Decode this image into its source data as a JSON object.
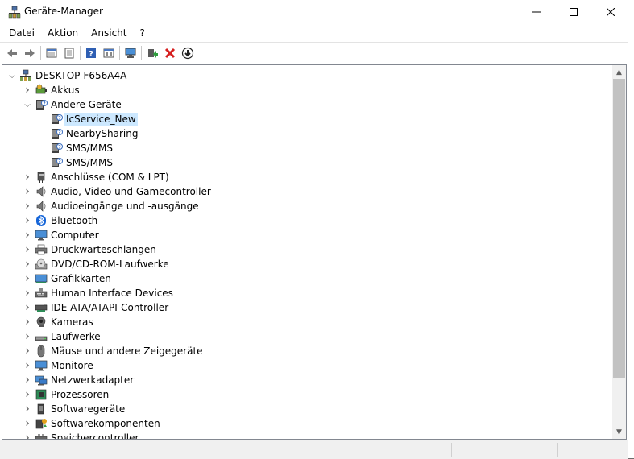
{
  "window": {
    "title": "Geräte-Manager"
  },
  "menu": [
    "Datei",
    "Aktion",
    "Ansicht",
    "?"
  ],
  "toolbar": [
    {
      "name": "back-icon"
    },
    {
      "name": "forward-icon"
    },
    {
      "sep": true
    },
    {
      "name": "properties-icon"
    },
    {
      "name": "details-icon"
    },
    {
      "sep": true
    },
    {
      "name": "help-icon"
    },
    {
      "name": "view-icon"
    },
    {
      "sep": true
    },
    {
      "name": "scan-hardware-icon"
    },
    {
      "sep": true
    },
    {
      "name": "update-driver-icon"
    },
    {
      "name": "uninstall-icon"
    },
    {
      "name": "disable-icon"
    }
  ],
  "tree": [
    {
      "label": "DESKTOP-F656A4A",
      "level": 0,
      "expander": "open",
      "icon": "computer-network"
    },
    {
      "label": "Akkus",
      "level": 1,
      "expander": "closed",
      "icon": "battery"
    },
    {
      "label": "Andere Geräte",
      "level": 1,
      "expander": "open",
      "icon": "unknown"
    },
    {
      "label": "IcService_New",
      "level": 2,
      "expander": "none",
      "icon": "unknown",
      "selected": true
    },
    {
      "label": "NearbySharing",
      "level": 2,
      "expander": "none",
      "icon": "unknown"
    },
    {
      "label": "SMS/MMS",
      "level": 2,
      "expander": "none",
      "icon": "unknown"
    },
    {
      "label": "SMS/MMS",
      "level": 2,
      "expander": "none",
      "icon": "unknown"
    },
    {
      "label": "Anschlüsse (COM & LPT)",
      "level": 1,
      "expander": "closed",
      "icon": "port"
    },
    {
      "label": "Audio, Video und Gamecontroller",
      "level": 1,
      "expander": "closed",
      "icon": "speaker"
    },
    {
      "label": "Audioeingänge und -ausgänge",
      "level": 1,
      "expander": "closed",
      "icon": "speaker"
    },
    {
      "label": "Bluetooth",
      "level": 1,
      "expander": "closed",
      "icon": "bluetooth"
    },
    {
      "label": "Computer",
      "level": 1,
      "expander": "closed",
      "icon": "monitor"
    },
    {
      "label": "Druckwarteschlangen",
      "level": 1,
      "expander": "closed",
      "icon": "printer"
    },
    {
      "label": "DVD/CD-ROM-Laufwerke",
      "level": 1,
      "expander": "closed",
      "icon": "disc"
    },
    {
      "label": "Grafikkarten",
      "level": 1,
      "expander": "closed",
      "icon": "display-adapter"
    },
    {
      "label": "Human Interface Devices",
      "level": 1,
      "expander": "closed",
      "icon": "hid"
    },
    {
      "label": "IDE ATA/ATAPI-Controller",
      "level": 1,
      "expander": "closed",
      "icon": "ide"
    },
    {
      "label": "Kameras",
      "level": 1,
      "expander": "closed",
      "icon": "camera"
    },
    {
      "label": "Laufwerke",
      "level": 1,
      "expander": "closed",
      "icon": "drive"
    },
    {
      "label": "Mäuse und andere Zeigegeräte",
      "level": 1,
      "expander": "closed",
      "icon": "mouse"
    },
    {
      "label": "Monitore",
      "level": 1,
      "expander": "closed",
      "icon": "monitor"
    },
    {
      "label": "Netzwerkadapter",
      "level": 1,
      "expander": "closed",
      "icon": "network"
    },
    {
      "label": "Prozessoren",
      "level": 1,
      "expander": "closed",
      "icon": "processor"
    },
    {
      "label": "Softwaregeräte",
      "level": 1,
      "expander": "closed",
      "icon": "software-device"
    },
    {
      "label": "Softwarekomponenten",
      "level": 1,
      "expander": "closed",
      "icon": "software-component"
    },
    {
      "label": "Speichercontroller",
      "level": 1,
      "expander": "closed",
      "icon": "storage"
    }
  ],
  "colors": {
    "selection": "#cce8ff",
    "scroll_thumb": "#c2c2c2",
    "accent": "#1a5fb4",
    "error": "#d62020"
  }
}
